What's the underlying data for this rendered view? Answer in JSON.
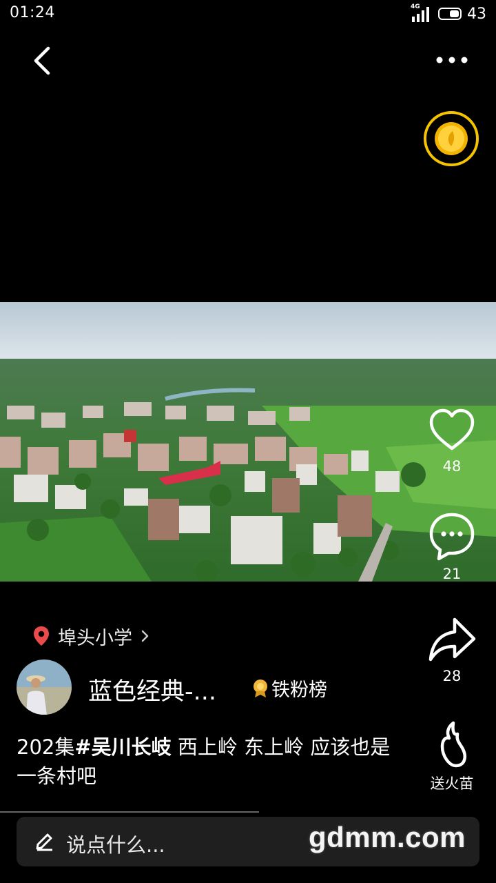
{
  "status_bar": {
    "time": "01:24",
    "network": "4G",
    "battery": "43"
  },
  "icons": {
    "back": "chevron-left-icon",
    "more": "more-horizontal-icon",
    "coin": "gold-coin-icon",
    "like": "heart-icon",
    "comment": "comment-bubble-icon",
    "share": "share-arrow-icon",
    "gift": "flame-icon",
    "location": "location-pin-icon",
    "badge": "medal-icon",
    "edit": "pencil-icon"
  },
  "actions": {
    "likes": "48",
    "comments": "21",
    "shares": "28",
    "gift_label": "送火苗"
  },
  "location": {
    "label": "埠头小学"
  },
  "author": {
    "name": "蓝色经典-...",
    "badge_label": "铁粉榜"
  },
  "caption": {
    "prefix": "202集",
    "tag": "#吴川长岐",
    "text": "  西上岭 东上岭 应该也是一条村吧"
  },
  "comment_input": {
    "placeholder": "说点什么..."
  },
  "watermark": "gdmm.com",
  "colors": {
    "accent_coin": "#f5c400",
    "pin": "#e94b4b",
    "background": "#000000"
  }
}
